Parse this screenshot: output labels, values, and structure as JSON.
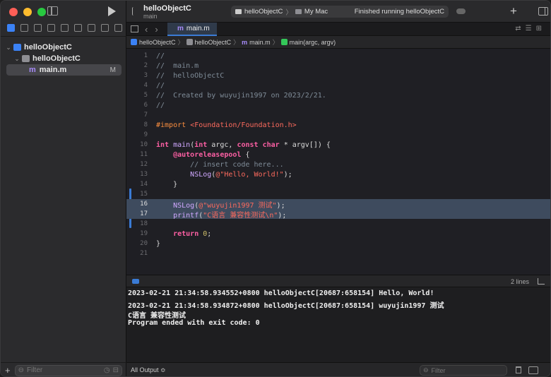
{
  "colors": {
    "close": "#ff5f57",
    "minimize": "#febc2e",
    "zoom": "#28c840",
    "accent": "#3a7bd5"
  },
  "toolbar": {
    "project_title": "helloObjectC",
    "branch": "main",
    "scheme_target": "helloObjectC",
    "scheme_separator": "〉",
    "destination": "My Mac",
    "run_status": "Finished running helloObjectC",
    "add_icon": "+"
  },
  "navigator": {
    "items": [
      {
        "label": "helloObjectC",
        "type": "project",
        "expanded": true
      },
      {
        "label": "helloObjectC",
        "type": "folder",
        "expanded": true
      },
      {
        "label": "main.m",
        "type": "file",
        "badge": "M",
        "selected": true
      }
    ],
    "filter_placeholder": "Filter",
    "add_icon": "+"
  },
  "tab": {
    "label": "main.m"
  },
  "jumpbar": {
    "crumbs": [
      "helloObjectC",
      "helloObjectC",
      "main.m",
      "main(argc, argv)"
    ],
    "separator": "〉"
  },
  "editor": {
    "line_numbers": [
      "1",
      "2",
      "3",
      "4",
      "5",
      "6",
      "7",
      "8",
      "9",
      "10",
      "11",
      "12",
      "13",
      "14",
      "15",
      "16",
      "17",
      "18",
      "19",
      "20",
      "21"
    ]
  },
  "debug": {
    "lines_count": "2 lines"
  },
  "console": {
    "lines": [
      "2023-02-21 21:34:58.934552+0800 helloObjectC[20687:658154] Hello, World!",
      "2023-02-21 21:34:58.934872+0800 helloObjectC[20687:658154] wuyujin1997 测试",
      "C语言 兼容性测试",
      "Program ended with exit code: 0"
    ],
    "output_selector": "All Output ≎",
    "filter_placeholder": "Filter"
  }
}
